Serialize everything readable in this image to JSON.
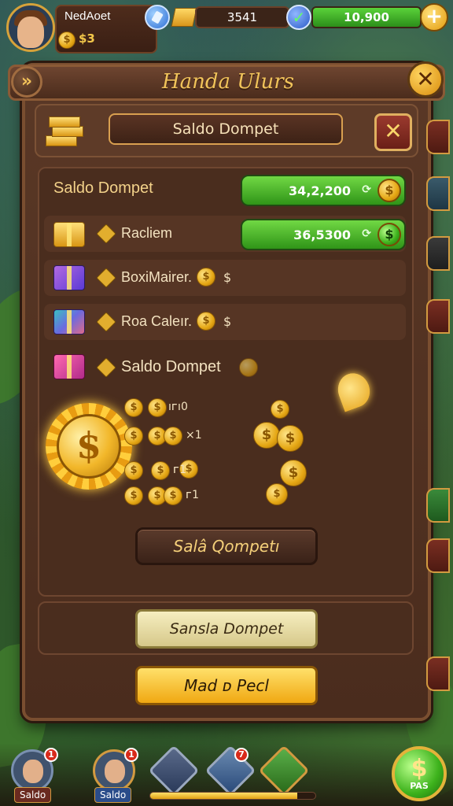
{
  "topbar": {
    "player_name": "NedAoet",
    "player_coins": "$3",
    "resource_gold": "3541",
    "resource_green": "10,900",
    "plus": "+"
  },
  "panel": {
    "title": "Handa Ulurs",
    "back": "»",
    "close": "✕"
  },
  "wallet": {
    "ribbon": "Saldo Dompet",
    "close": "✕"
  },
  "balance": {
    "label": "Saldo Dompet",
    "value_primary": "34,2,200",
    "value_secondary": "36,5300",
    "mini_icon": "⟳",
    "coin_symbol": "$"
  },
  "rows": [
    {
      "label": "Racliem",
      "icon": "gold-bars"
    },
    {
      "label": "BoxiMairer.",
      "icon": "gift-box-purple",
      "dollar": "$"
    },
    {
      "label": "Roa Caleır.",
      "icon": "gift-box-multicolor",
      "dollar": "$"
    },
    {
      "label": "Saldo Dompet",
      "icon": "gift-box-pink"
    }
  ],
  "coins": {
    "seal_symbol": "$",
    "line1": "ıᴦı0",
    "line2": "×1",
    "line3": "ᴦ1",
    "line4": "ᴦ1"
  },
  "buttons": {
    "dark": "Salâ Qompetı",
    "cream": "Sansla Dompet",
    "gold": "Mad ᴅ Pecl"
  },
  "bottom": {
    "avatar1_label": "Saldo",
    "avatar2_label": "Saldo",
    "badge1": "1",
    "badge2": "1",
    "badge3": "7",
    "big_coin_symbol": "$",
    "big_coin_label": "PAS",
    "progress": 0.89
  }
}
